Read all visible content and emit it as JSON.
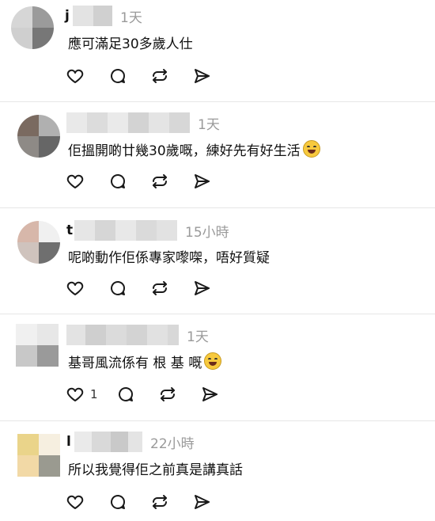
{
  "colors": {
    "accent_text": "#111111",
    "muted": "#9a9a9a",
    "divider": "#e6e6e6"
  },
  "comments": [
    {
      "name": "j",
      "time": "1天",
      "text": "應可滿足30多歲人仕",
      "emoji": null,
      "like_count": ""
    },
    {
      "name": "",
      "time": "1天",
      "text": "佢搵開啲廿幾30歲嘅，練好先有好生活",
      "emoji": "sweat-smile",
      "like_count": ""
    },
    {
      "name": "t",
      "time": "15小時",
      "text": "呢啲動作佢係專家嚟㗎，唔好質疑",
      "emoji": null,
      "like_count": ""
    },
    {
      "name": "",
      "time": "1天",
      "text": "基哥風流係有 根 基 嘅",
      "emoji": "laughing-tears",
      "like_count": "1"
    },
    {
      "name": "l",
      "time": "22小時",
      "text": "所以我覺得佢之前真是講真話",
      "emoji": null,
      "like_count": ""
    }
  ],
  "icons": [
    "heart-icon",
    "comment-icon",
    "repost-icon",
    "share-icon"
  ]
}
